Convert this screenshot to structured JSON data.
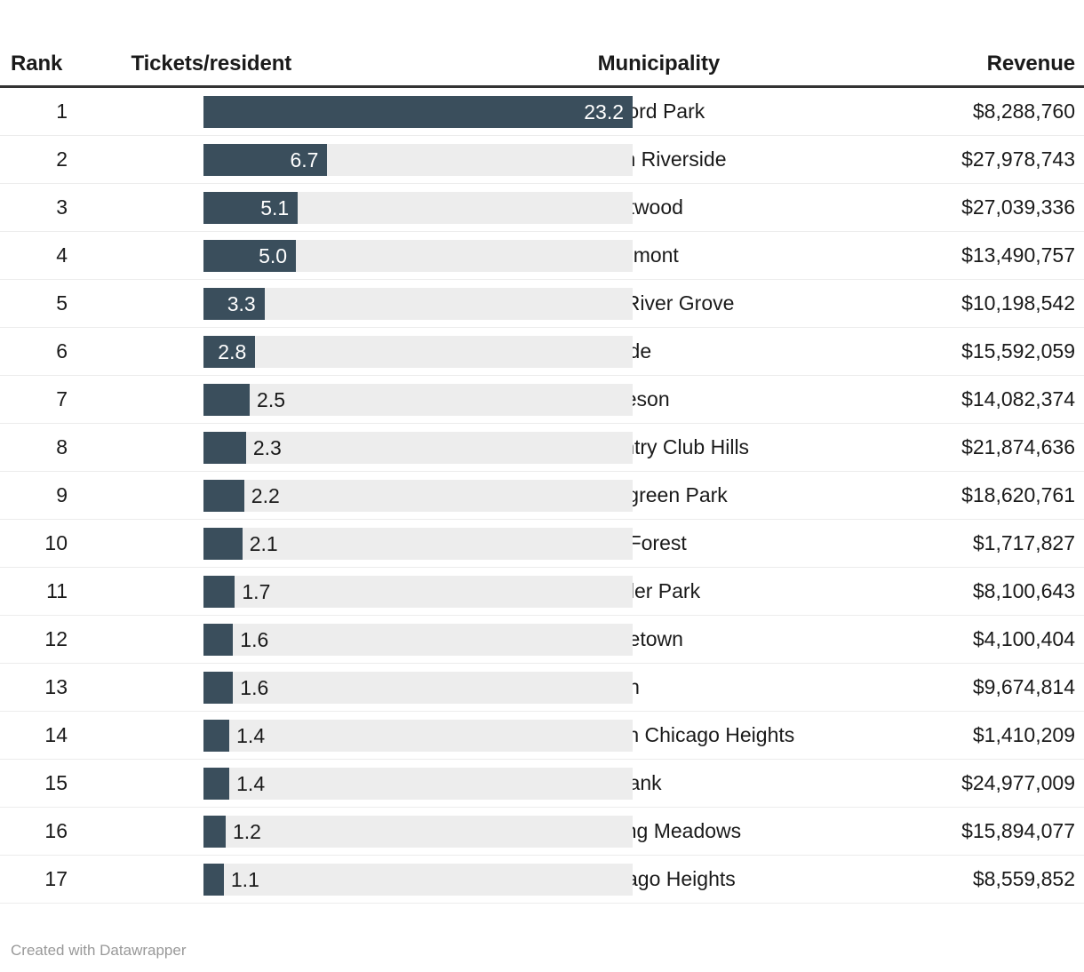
{
  "columns": {
    "rank": "Rank",
    "bar": "Tickets/resident",
    "municipality": "Municipality",
    "revenue": "Revenue"
  },
  "footer": {
    "credit": "Created with Datawrapper"
  },
  "colors": {
    "bar_fill": "#3a4e5c",
    "bar_track": "#ededed",
    "header_rule": "#333333",
    "row_separator": "#ececec",
    "text": "#1a1a1a",
    "footer_text": "#999999",
    "label_inside": "#ffffff"
  },
  "chart_data": {
    "type": "bar",
    "title": "",
    "subtitle": "",
    "xlabel": "Tickets/resident",
    "ylabel": "",
    "orientation": "horizontal",
    "grid": false,
    "legend": null,
    "xlim": [
      0,
      23.2
    ],
    "max_value": 23.2,
    "categories": [
      "Bedford Park",
      "North Riverside",
      "Crestwood",
      "Rosemont",
      "Fox River Grove",
      "Hillside",
      "Matteson",
      "Country Club Hills",
      "Evergreen Park",
      "Oak Forest",
      "Schiller Park",
      "Hometown",
      "Worth",
      "South Chicago Heights",
      "Burbank",
      "Rolling Meadows",
      "Chicago Heights"
    ],
    "values": [
      23.2,
      6.7,
      5.1,
      5.0,
      3.3,
      2.8,
      2.5,
      2.3,
      2.2,
      2.1,
      1.7,
      1.6,
      1.6,
      1.4,
      1.4,
      1.2,
      1.1
    ],
    "value_labels": [
      "23.2",
      "6.7",
      "5.1",
      "5.0",
      "3.3",
      "2.8",
      "2.5",
      "2.3",
      "2.2",
      "2.1",
      "1.7",
      "1.6",
      "1.6",
      "1.4",
      "1.4",
      "1.2",
      "1.1"
    ],
    "series": [
      {
        "name": "Tickets/resident",
        "values": [
          23.2,
          6.7,
          5.1,
          5.0,
          3.3,
          2.8,
          2.5,
          2.3,
          2.2,
          2.1,
          1.7,
          1.6,
          1.6,
          1.4,
          1.4,
          1.2,
          1.1
        ]
      }
    ],
    "extra_columns": {
      "Rank": [
        1,
        2,
        3,
        4,
        5,
        6,
        7,
        8,
        9,
        10,
        11,
        12,
        13,
        14,
        15,
        16,
        17
      ],
      "Revenue": [
        "$8,288,760",
        "$27,978,743",
        "$27,039,336",
        "$13,490,757",
        "$10,198,542",
        "$15,592,059",
        "$14,082,374",
        "$21,874,636",
        "$18,620,761",
        "$1,717,827",
        "$8,100,643",
        "$4,100,404",
        "$9,674,814",
        "$1,410,209",
        "$24,977,009",
        "$15,894,077",
        "$8,559,852"
      ]
    }
  },
  "rows": [
    {
      "rank": "1",
      "value": 23.2,
      "label": "23.2",
      "label_inside": true,
      "municipality": "Bedford Park",
      "revenue": "$8,288,760"
    },
    {
      "rank": "2",
      "value": 6.7,
      "label": "6.7",
      "label_inside": true,
      "municipality": "North Riverside",
      "revenue": "$27,978,743"
    },
    {
      "rank": "3",
      "value": 5.1,
      "label": "5.1",
      "label_inside": true,
      "municipality": "Crestwood",
      "revenue": "$27,039,336"
    },
    {
      "rank": "4",
      "value": 5.0,
      "label": "5.0",
      "label_inside": true,
      "municipality": "Rosemont",
      "revenue": "$13,490,757"
    },
    {
      "rank": "5",
      "value": 3.3,
      "label": "3.3",
      "label_inside": true,
      "municipality": "Fox River Grove",
      "revenue": "$10,198,542"
    },
    {
      "rank": "6",
      "value": 2.8,
      "label": "2.8",
      "label_inside": true,
      "municipality": "Hillside",
      "revenue": "$15,592,059"
    },
    {
      "rank": "7",
      "value": 2.5,
      "label": "2.5",
      "label_inside": false,
      "municipality": "Matteson",
      "revenue": "$14,082,374"
    },
    {
      "rank": "8",
      "value": 2.3,
      "label": "2.3",
      "label_inside": false,
      "municipality": "Country Club Hills",
      "revenue": "$21,874,636"
    },
    {
      "rank": "9",
      "value": 2.2,
      "label": "2.2",
      "label_inside": false,
      "municipality": "Evergreen Park",
      "revenue": "$18,620,761"
    },
    {
      "rank": "10",
      "value": 2.1,
      "label": "2.1",
      "label_inside": false,
      "municipality": "Oak Forest",
      "revenue": "$1,717,827"
    },
    {
      "rank": "11",
      "value": 1.7,
      "label": "1.7",
      "label_inside": false,
      "municipality": "Schiller Park",
      "revenue": "$8,100,643"
    },
    {
      "rank": "12",
      "value": 1.6,
      "label": "1.6",
      "label_inside": false,
      "municipality": "Hometown",
      "revenue": "$4,100,404"
    },
    {
      "rank": "13",
      "value": 1.6,
      "label": "1.6",
      "label_inside": false,
      "municipality": "Worth",
      "revenue": "$9,674,814"
    },
    {
      "rank": "14",
      "value": 1.4,
      "label": "1.4",
      "label_inside": false,
      "municipality": "South Chicago Heights",
      "revenue": "$1,410,209"
    },
    {
      "rank": "15",
      "value": 1.4,
      "label": "1.4",
      "label_inside": false,
      "municipality": "Burbank",
      "revenue": "$24,977,009"
    },
    {
      "rank": "16",
      "value": 1.2,
      "label": "1.2",
      "label_inside": false,
      "municipality": "Rolling Meadows",
      "revenue": "$15,894,077"
    },
    {
      "rank": "17",
      "value": 1.1,
      "label": "1.1",
      "label_inside": false,
      "municipality": "Chicago Heights",
      "revenue": "$8,559,852"
    }
  ]
}
